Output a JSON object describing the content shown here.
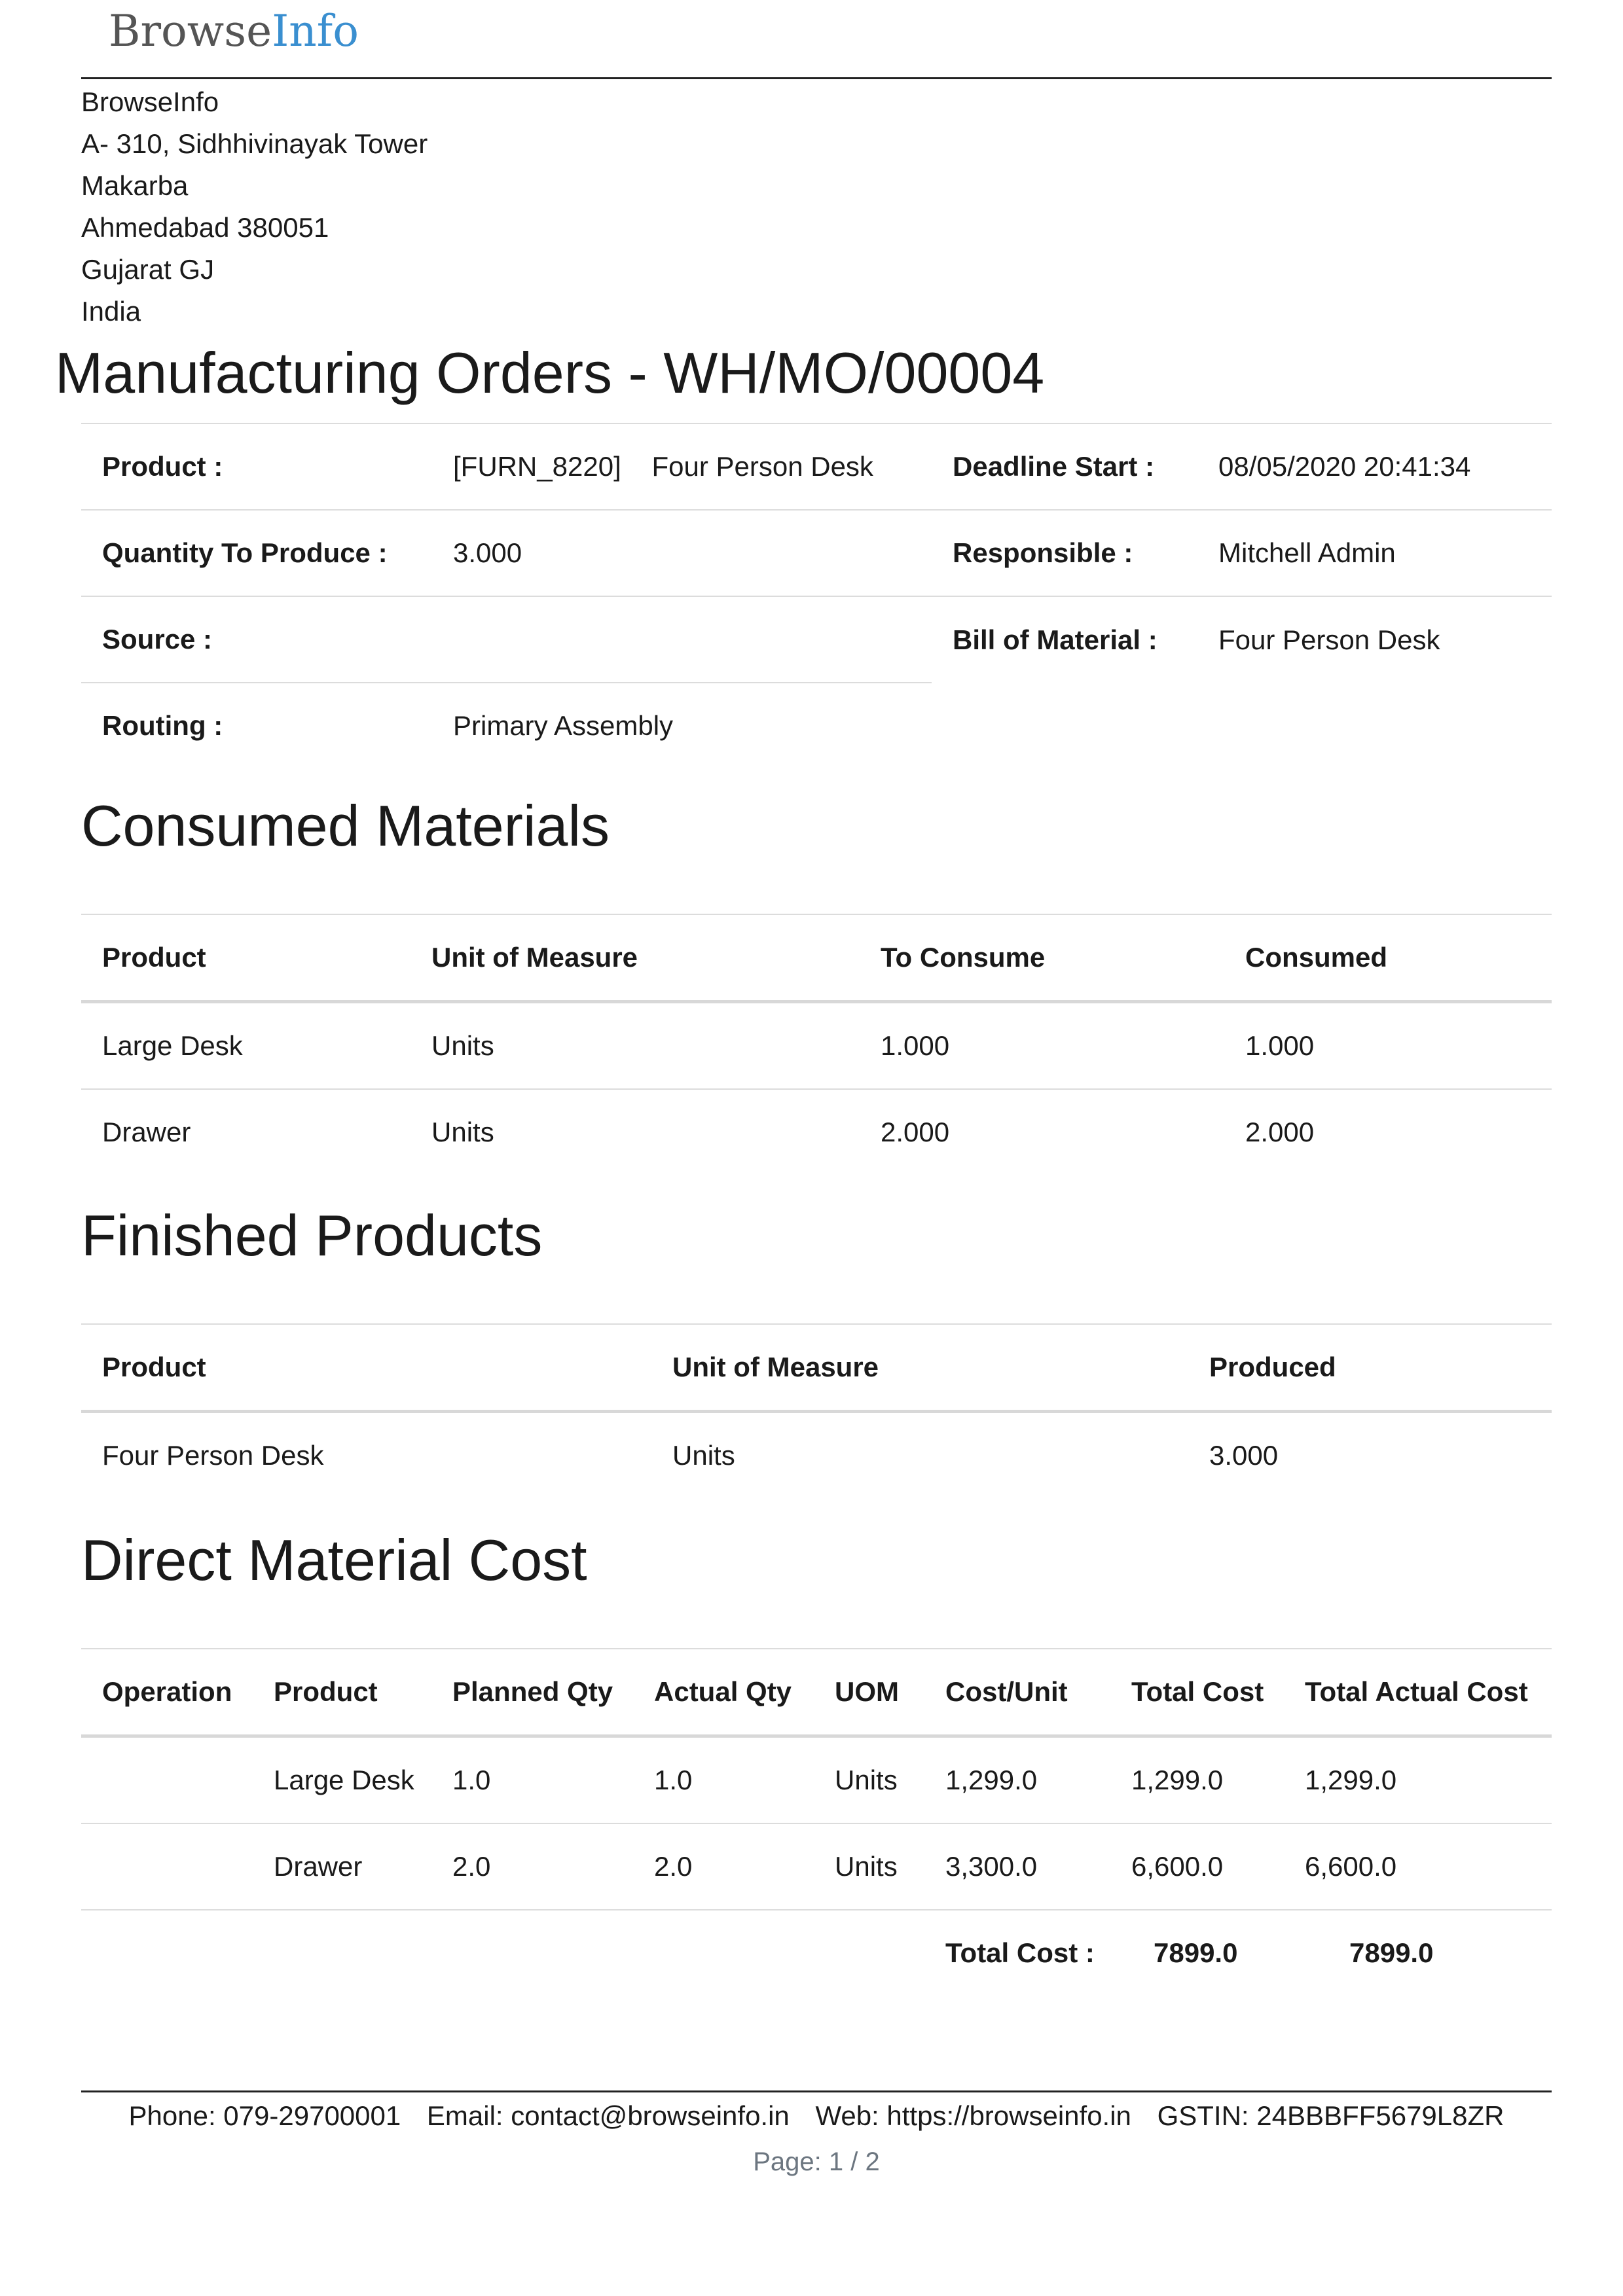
{
  "logo": {
    "text_main": "Browse",
    "text_accent": "Info"
  },
  "company": {
    "address_lines": [
      "BrowseInfo",
      "A- 310, Sidhhivinayak Tower",
      "Makarba",
      "Ahmedabad 380051",
      "Gujarat GJ",
      "India"
    ]
  },
  "title": "Manufacturing Orders - WH/MO/00004",
  "info": {
    "product_label": "Product :",
    "product_code": "[FURN_8220]",
    "product_name": "Four Person Desk",
    "deadline_label": "Deadline Start :",
    "deadline_value": "08/05/2020 20:41:34",
    "qty_label": "Quantity To Produce :",
    "qty_value": "3.000",
    "responsible_label": "Responsible :",
    "responsible_value": "Mitchell Admin",
    "source_label": "Source :",
    "source_value": "",
    "bom_label": "Bill of Material :",
    "bom_value": "Four Person Desk",
    "routing_label": "Routing :",
    "routing_value": "Primary Assembly"
  },
  "consumed": {
    "title": "Consumed Materials",
    "headers": [
      "Product",
      "Unit of Measure",
      "To Consume",
      "Consumed"
    ],
    "rows": [
      [
        "Large Desk",
        "Units",
        "1.000",
        "1.000"
      ],
      [
        "Drawer",
        "Units",
        "2.000",
        "2.000"
      ]
    ]
  },
  "finished": {
    "title": "Finished Products",
    "headers": [
      "Product",
      "Unit of Measure",
      "Produced"
    ],
    "rows": [
      [
        "Four Person Desk",
        "Units",
        "3.000"
      ]
    ]
  },
  "cost": {
    "title": "Direct Material Cost",
    "headers": [
      "Operation",
      "Product",
      "Planned Qty",
      "Actual Qty",
      "UOM",
      "Cost/Unit",
      "Total Cost",
      "Total Actual Cost"
    ],
    "rows": [
      [
        "",
        "Large Desk",
        "1.0",
        "1.0",
        "Units",
        "1,299.0",
        "1,299.0",
        "1,299.0"
      ],
      [
        "",
        "Drawer",
        "2.0",
        "2.0",
        "Units",
        "3,300.0",
        "6,600.0",
        "6,600.0"
      ]
    ],
    "total_label": "Total Cost :",
    "total_cost": "7899.0",
    "total_actual_cost": "7899.0"
  },
  "footer": {
    "phone": "Phone: 079-29700001",
    "email": "Email: contact@browseinfo.in",
    "web": "Web: https://browseinfo.in",
    "gstin": "GSTIN: 24BBBFF5679L8ZR",
    "page": "Page: 1 / 2"
  }
}
